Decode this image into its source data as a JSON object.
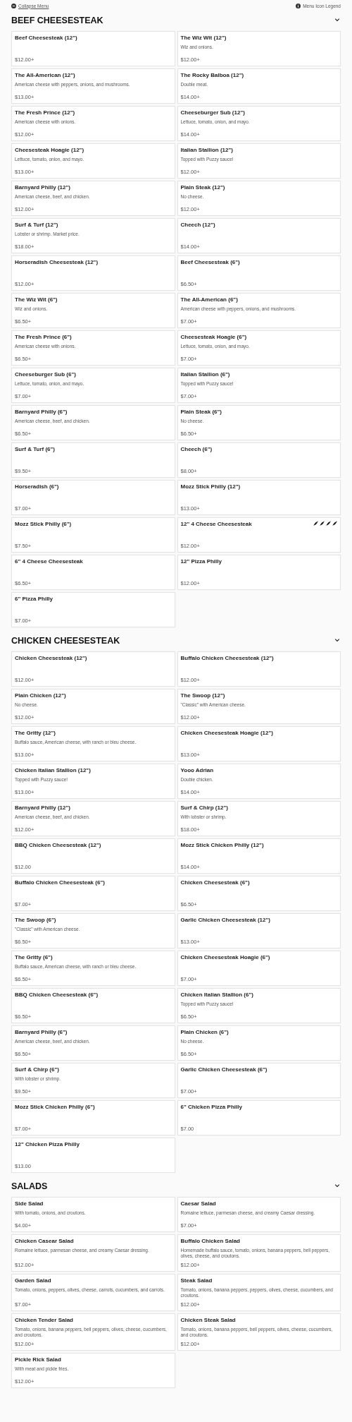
{
  "top_bar": {
    "collapse_link": "Collapse Menu",
    "legend_link": "Menu Icon Legend"
  },
  "sections": [
    {
      "title": "BEEF CHEESESTEAK",
      "expanded": true,
      "items": [
        {
          "name": "Beef Cheesesteak (12\")",
          "price": "$12.00+"
        },
        {
          "name": "The Wiz Wit (12\")",
          "description": "Wiz and onions.",
          "price": "$12.00+"
        },
        {
          "name": "The All-American (12\")",
          "description": "American cheese with peppers, onions, and mushrooms.",
          "price": "$13.00+"
        },
        {
          "name": "The Rocky Balboa (12\")",
          "description": "Double meat.",
          "price": "$14.00+"
        },
        {
          "name": "The Fresh Prince (12\")",
          "description": "American cheese with onions.",
          "price": "$12.00+"
        },
        {
          "name": "Cheeseburger Sub (12\")",
          "description": "Lettuce, tomato, onion, and mayo.",
          "price": "$14.00+"
        },
        {
          "name": "Cheesesteak Hoagie (12\")",
          "description": "Lettuce, tomato, onion, and mayo.",
          "price": "$13.00+"
        },
        {
          "name": "Italian Stallion (12\")",
          "description": "Topped with Puzzy sauce!",
          "price": "$12.00+"
        },
        {
          "name": "Barnyard Philly (12\")",
          "description": "American cheese, beef, and chicken.",
          "price": "$12.00+"
        },
        {
          "name": "Plain Steak (12\")",
          "description": "No cheese.",
          "price": "$12.00+"
        },
        {
          "name": "Surf & Turf (12\")",
          "description": "Lobster or shrimp. Market price.",
          "price": "$18.00+"
        },
        {
          "name": "Cheech (12\")",
          "price": "$14.00+"
        },
        {
          "name": "Horseradish Cheesesteak (12\")",
          "price": "$12.00+"
        },
        {
          "name": "Beef Cheesesteak (6\")",
          "price": "$6.50+"
        },
        {
          "name": "The Wiz Wit (6\")",
          "description": "Wiz and onions.",
          "price": "$6.50+"
        },
        {
          "name": "The All-American (6\")",
          "description": "American cheese with peppers, onions, and mushrooms.",
          "price": "$7.00+"
        },
        {
          "name": "The Fresh Prince (6\")",
          "description": "American cheese with onions.",
          "price": "$6.50+"
        },
        {
          "name": "Cheesesteak Hoagie (6\")",
          "description": "Lettuce, tomato, onion, and mayo.",
          "price": "$7.00+"
        },
        {
          "name": "Cheeseburger Sub (6\")",
          "description": "Lettuce, tomato, onion, and mayo.",
          "price": "$7.00+"
        },
        {
          "name": "Italian Stallion (6\")",
          "description": "Topped with Puzzy sauce!",
          "price": "$7.00+"
        },
        {
          "name": "Barnyard Philly (6\")",
          "description": "American cheese, beef, and chicken.",
          "price": "$6.50+"
        },
        {
          "name": "Plain Steak (6\")",
          "description": "No cheese.",
          "price": "$6.50+"
        },
        {
          "name": "Surf & Turf (6\")",
          "price": "$9.50+"
        },
        {
          "name": "Cheech (6\")",
          "price": "$8.00+"
        },
        {
          "name": "Horseradish (6\")",
          "price": "$7.00+"
        },
        {
          "name": "Mozz Stick Philly (12\")",
          "price": "$13.00+"
        },
        {
          "name": "Mozz Stick Philly (6\")",
          "price": "$7.50+"
        },
        {
          "name": "12\" 4 Cheese Cheesesteak",
          "icons": [
            {
              "kind": "pepper"
            },
            {
              "kind": "pepper"
            },
            {
              "kind": "pepper"
            },
            {
              "kind": "pepper"
            }
          ],
          "price": "$12.00+"
        },
        {
          "name": "6\" 4 Cheese Cheesesteak",
          "price": "$6.50+"
        },
        {
          "name": "12\" Pizza Philly",
          "price": "$12.00+"
        },
        {
          "name": "6\" Pizza Philly",
          "price": "$7.00+"
        }
      ]
    },
    {
      "title": "CHICKEN CHEESESTEAK",
      "expanded": true,
      "items": [
        {
          "name": "Chicken Cheesesteak (12\")",
          "price": "$12.00+"
        },
        {
          "name": "Buffalo Chicken Cheesesteak (12\")",
          "price": "$12.00+"
        },
        {
          "name": "Plain Chicken (12\")",
          "description": "No cheese.",
          "price": "$12.00+"
        },
        {
          "name": "The Swoop (12\")",
          "description": "\"Classic\" with American cheese.",
          "price": "$12.00+"
        },
        {
          "name": "The Gritty (12\")",
          "description": "Buffalo sauce, American cheese, with ranch or bleu cheese.",
          "price": "$13.00+"
        },
        {
          "name": "Chicken Cheesesteak Hoagie (12\")",
          "price": "$13.00+"
        },
        {
          "name": "Chicken Italian Stallion (12\")",
          "description": "Topped with Puzzy sauce!",
          "price": "$13.00+"
        },
        {
          "name": "Yooo Adrian",
          "description": "Double chicken.",
          "price": "$14.00+"
        },
        {
          "name": "Barnyard Philly (12\")",
          "description": "American cheese, beef, and chicken.",
          "price": "$12.00+"
        },
        {
          "name": "Surf & Chirp (12\")",
          "description": "With lobster or shrimp.",
          "price": "$18.00+"
        },
        {
          "name": "BBQ Chicken Cheesesteak (12\")",
          "price": "$12.00"
        },
        {
          "name": "Mozz Stick Chicken Philly (12\")",
          "price": "$14.00+"
        },
        {
          "name": "Buffalo Chicken Cheesesteak (6\")",
          "price": "$7.00+"
        },
        {
          "name": "Chicken Cheesesteak (6\")",
          "price": "$6.50+"
        },
        {
          "name": "The Swoop (6\")",
          "description": "\"Classic\" with American cheese.",
          "price": "$6.50+"
        },
        {
          "name": "Garlic Chicken Cheesesteak (12\")",
          "price": "$13.00+"
        },
        {
          "name": "The Gritty (6\")",
          "description": "Buffalo sauce, American cheese, with ranch or bleu cheese.",
          "price": "$6.50+"
        },
        {
          "name": "Chicken Cheesesteak Hoagie (6\")",
          "price": "$7.00+"
        },
        {
          "name": "BBQ Chicken Cheesesteak (6\")",
          "price": "$6.50+"
        },
        {
          "name": "Chicken Italian Stallion (6\")",
          "description": "Topped with Puzzy sauce!",
          "price": "$6.50+"
        },
        {
          "name": "Barnyard Philly (6\")",
          "description": "American cheese, beef, and chicken.",
          "price": "$6.50+"
        },
        {
          "name": "Plain Chicken (6\")",
          "description": "No cheese.",
          "price": "$6.50+"
        },
        {
          "name": "Surf & Chirp (6\")",
          "description": "With lobster or shrimp.",
          "price": "$9.50+"
        },
        {
          "name": "Garlic Chicken Cheesesteak (6\")",
          "price": "$7.00+"
        },
        {
          "name": "Mozz Stick Chicken Philly (6\")",
          "price": "$7.00+"
        },
        {
          "name": "6\" Chicken Pizza Philly",
          "price": "$7.00"
        },
        {
          "name": "12\" Chicken Pizza Philly",
          "price": "$13.00"
        }
      ]
    },
    {
      "title": "SALADS",
      "expanded": true,
      "items": [
        {
          "name": "Side Salad",
          "description": "With tomato, onions, and croutons.",
          "price": "$4.00+"
        },
        {
          "name": "Caesar Salad",
          "description": "Romaine lettuce, parmesan cheese, and creamy Caesar dressing.",
          "price": "$7.00+"
        },
        {
          "name": "Chicken Casear Salad",
          "description": "Romaine lettuce, parmesan cheese, and creamy Caesar dressing.",
          "price": "$12.00+"
        },
        {
          "name": "Buffalo Chicken Salad",
          "description": "Homemade buffalo sauce, tomato, onions, banana peppers, bell peppers, olives, cheese, and croutons.",
          "price": "$12.00+"
        },
        {
          "name": "Garden Salad",
          "description": "Tomato, onions, peppers, olives, cheese, carrots, cucumbers, and carrots.",
          "price": "$7.00+"
        },
        {
          "name": "Steak Salad",
          "description": "Tomato, onions, banana peppers, peppers, olives, cheese, cucumbers, and croutons.",
          "price": "$12.00+"
        },
        {
          "name": "Chicken Tender Salad",
          "description": "Tomato, onions, banana peppers, bell peppers, olives, cheese, cucumbers, and croutons.",
          "price": "$12.00+"
        },
        {
          "name": "Chicken Steak Salad",
          "description": "Tomato, onions, banana peppers, bell peppers, olives, cheese, cucumbers, and croutons.",
          "price": "$12.00+"
        },
        {
          "name": "Pickle Rick Salad",
          "description": "With meat and pickle fries.",
          "price": "$12.00+"
        }
      ]
    }
  ]
}
